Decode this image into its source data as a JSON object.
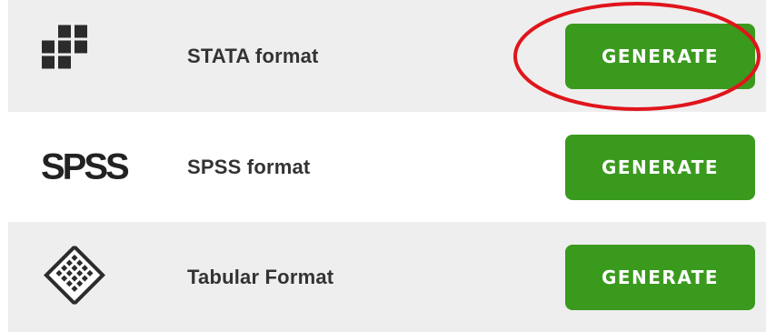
{
  "rows": [
    {
      "icon": "stata-grid-icon",
      "label": "STATA format",
      "button_label": "GENERATE"
    },
    {
      "icon": "spss-logo",
      "logo_text": "SPSS",
      "label": "SPSS format",
      "button_label": "GENERATE"
    },
    {
      "icon": "tabular-grid-icon",
      "label": "Tabular Format",
      "button_label": "GENERATE"
    }
  ],
  "colors": {
    "button_green": "#3a9a1e",
    "shaded_row": "#eeeeee",
    "highlight_red": "#e0151b"
  }
}
